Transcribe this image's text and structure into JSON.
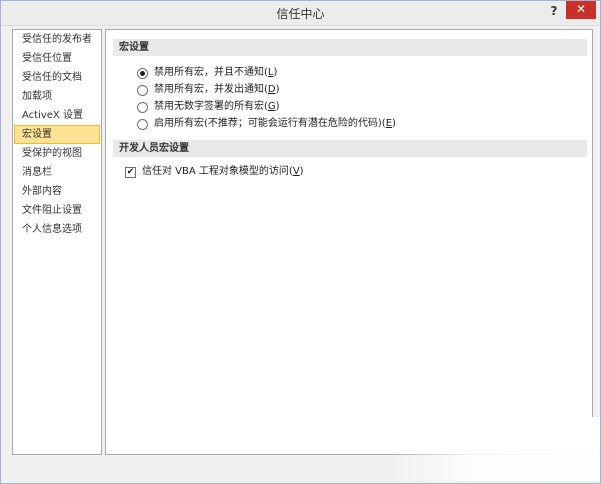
{
  "window": {
    "title": "信任中心",
    "help_label": "?",
    "close_label": "✕"
  },
  "sidebar": {
    "items": [
      {
        "label": "受信任的发布者"
      },
      {
        "label": "受信任位置"
      },
      {
        "label": "受信任的文档"
      },
      {
        "label": "加载项"
      },
      {
        "label": "ActiveX 设置"
      },
      {
        "label": "宏设置"
      },
      {
        "label": "受保护的视图"
      },
      {
        "label": "消息栏"
      },
      {
        "label": "外部内容"
      },
      {
        "label": "文件阻止设置"
      },
      {
        "label": "个人信息选项"
      }
    ],
    "selected_index": 5
  },
  "macro_settings": {
    "header": "宏设置",
    "options": [
      {
        "text": "禁用所有宏，并且不通知(",
        "key": "L",
        "end": ")",
        "checked": true
      },
      {
        "text": "禁用所有宏，并发出通知(",
        "key": "D",
        "end": ")",
        "checked": false
      },
      {
        "text": "禁用无数字签署的所有宏(",
        "key": "G",
        "end": ")",
        "checked": false
      },
      {
        "text": "启用所有宏(不推荐；可能会运行有潜在危险的代码)(",
        "key": "E",
        "end": ")",
        "checked": false
      }
    ]
  },
  "developer_macro_settings": {
    "header": "开发人员宏设置",
    "trust_vba": {
      "text": "信任对 VBA 工程对象模型的访问(",
      "key": "V",
      "end": ")",
      "checked": true,
      "check_glyph": "✔"
    }
  }
}
